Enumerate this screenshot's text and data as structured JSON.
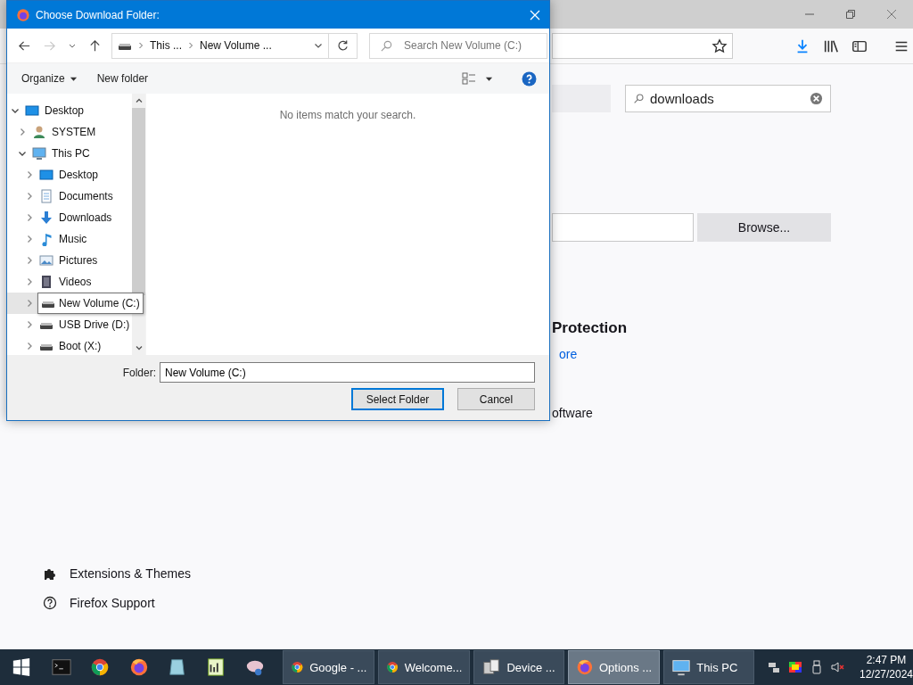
{
  "browser": {
    "search": {
      "value": "downloads"
    },
    "browse_button": "Browse...",
    "heading": "Protection",
    "link": "ore",
    "text": "oftware",
    "nav": [
      {
        "label": "Extensions & Themes",
        "kind": "extensions"
      },
      {
        "label": "Firefox Support",
        "kind": "support"
      }
    ]
  },
  "dialog": {
    "title": "Choose Download Folder:",
    "breadcrumb": [
      "This ...",
      "New Volume ..."
    ],
    "search": {
      "placeholder": "Search New Volume (C:)"
    },
    "commands": [
      "Organize",
      "New folder"
    ],
    "empty_message": "No items match your search.",
    "tree": [
      {
        "label": "Desktop",
        "kind": "desktop",
        "expanded": true,
        "hovered": false,
        "children": [
          {
            "label": "SYSTEM",
            "kind": "user",
            "expanded": false,
            "hovered": false
          },
          {
            "label": "This PC",
            "kind": "pc",
            "expanded": true,
            "hovered": false,
            "children": [
              {
                "label": "Desktop",
                "kind": "desktop",
                "expanded": false,
                "hovered": false
              },
              {
                "label": "Documents",
                "kind": "documents",
                "expanded": false,
                "hovered": false
              },
              {
                "label": "Downloads",
                "kind": "downloads",
                "expanded": false,
                "hovered": false
              },
              {
                "label": "Music",
                "kind": "music",
                "expanded": false,
                "hovered": false
              },
              {
                "label": "Pictures",
                "kind": "pictures",
                "expanded": false,
                "hovered": false
              },
              {
                "label": "Videos",
                "kind": "videos",
                "expanded": false,
                "hovered": false
              },
              {
                "label": "New Volume (C:)",
                "kind": "drive",
                "expanded": false,
                "hovered": true
              },
              {
                "label": "USB Drive (D:)",
                "kind": "drive",
                "expanded": false,
                "hovered": false
              },
              {
                "label": "Boot (X:)",
                "kind": "drive",
                "expanded": false,
                "hovered": false
              }
            ]
          }
        ]
      }
    ],
    "folder_label": "Folder:",
    "folder_value": "New Volume (C:)",
    "buttons": [
      {
        "label": "Select Folder",
        "default": true
      },
      {
        "label": "Cancel",
        "default": false
      }
    ]
  },
  "taskbar": {
    "pinned": [
      {
        "kind": "start"
      },
      {
        "kind": "terminal"
      },
      {
        "kind": "chrome"
      },
      {
        "kind": "firefox"
      },
      {
        "kind": "glass"
      },
      {
        "kind": "chart"
      },
      {
        "kind": "paint"
      }
    ],
    "tasks": [
      {
        "label": "Google - ...",
        "kind": "chrome",
        "selected": false
      },
      {
        "label": "Welcome...",
        "kind": "chrome",
        "selected": false
      },
      {
        "label": "Device ...",
        "kind": "device",
        "selected": false
      },
      {
        "label": "Options ...",
        "kind": "firefox",
        "selected": true
      },
      {
        "label": "This PC",
        "kind": "pc",
        "selected": false
      }
    ],
    "clock": {
      "time": "2:47 PM",
      "date": "12/27/2024"
    }
  }
}
